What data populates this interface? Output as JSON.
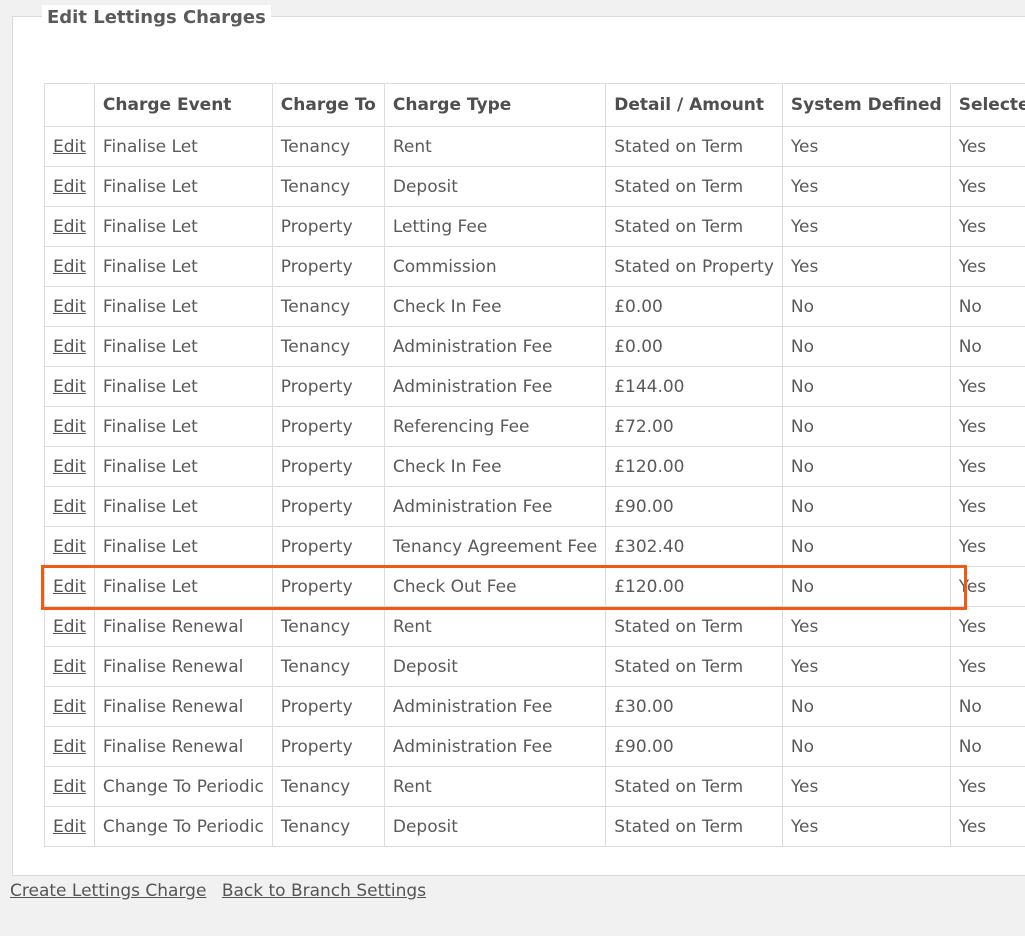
{
  "panel": {
    "title": "Edit Lettings Charges"
  },
  "table": {
    "headers": [
      "",
      "Charge Event",
      "Charge To",
      "Charge Type",
      "Detail / Amount",
      "System Defined",
      "Selected"
    ],
    "rows": [
      {
        "edit": "Edit",
        "event": "Finalise Let",
        "to": "Tenancy",
        "type": "Rent",
        "detail": "Stated on Term",
        "system": "Yes",
        "selected": "Yes"
      },
      {
        "edit": "Edit",
        "event": "Finalise Let",
        "to": "Tenancy",
        "type": "Deposit",
        "detail": "Stated on Term",
        "system": "Yes",
        "selected": "Yes"
      },
      {
        "edit": "Edit",
        "event": "Finalise Let",
        "to": "Property",
        "type": "Letting Fee",
        "detail": "Stated on Term",
        "system": "Yes",
        "selected": "Yes"
      },
      {
        "edit": "Edit",
        "event": "Finalise Let",
        "to": "Property",
        "type": "Commission",
        "detail": "Stated on Property",
        "system": "Yes",
        "selected": "Yes"
      },
      {
        "edit": "Edit",
        "event": "Finalise Let",
        "to": "Tenancy",
        "type": "Check In Fee",
        "detail": "£0.00",
        "system": "No",
        "selected": "No"
      },
      {
        "edit": "Edit",
        "event": "Finalise Let",
        "to": "Tenancy",
        "type": "Administration Fee",
        "detail": "£0.00",
        "system": "No",
        "selected": "No"
      },
      {
        "edit": "Edit",
        "event": "Finalise Let",
        "to": "Property",
        "type": "Administration Fee",
        "detail": "£144.00",
        "system": "No",
        "selected": "Yes"
      },
      {
        "edit": "Edit",
        "event": "Finalise Let",
        "to": "Property",
        "type": "Referencing Fee",
        "detail": "£72.00",
        "system": "No",
        "selected": "Yes"
      },
      {
        "edit": "Edit",
        "event": "Finalise Let",
        "to": "Property",
        "type": "Check In Fee",
        "detail": "£120.00",
        "system": "No",
        "selected": "Yes"
      },
      {
        "edit": "Edit",
        "event": "Finalise Let",
        "to": "Property",
        "type": "Administration Fee",
        "detail": "£90.00",
        "system": "No",
        "selected": "Yes"
      },
      {
        "edit": "Edit",
        "event": "Finalise Let",
        "to": "Property",
        "type": "Tenancy Agreement Fee",
        "detail": "£302.40",
        "system": "No",
        "selected": "Yes"
      },
      {
        "edit": "Edit",
        "event": "Finalise Let",
        "to": "Property",
        "type": "Check Out Fee",
        "detail": "£120.00",
        "system": "No",
        "selected": "Yes"
      },
      {
        "edit": "Edit",
        "event": "Finalise Renewal",
        "to": "Tenancy",
        "type": "Rent",
        "detail": "Stated on Term",
        "system": "Yes",
        "selected": "Yes"
      },
      {
        "edit": "Edit",
        "event": "Finalise Renewal",
        "to": "Tenancy",
        "type": "Deposit",
        "detail": "Stated on Term",
        "system": "Yes",
        "selected": "Yes"
      },
      {
        "edit": "Edit",
        "event": "Finalise Renewal",
        "to": "Property",
        "type": "Administration Fee",
        "detail": "£30.00",
        "system": "No",
        "selected": "No"
      },
      {
        "edit": "Edit",
        "event": "Finalise Renewal",
        "to": "Property",
        "type": "Administration Fee",
        "detail": "£90.00",
        "system": "No",
        "selected": "No"
      },
      {
        "edit": "Edit",
        "event": "Change To Periodic",
        "to": "Tenancy",
        "type": "Rent",
        "detail": "Stated on Term",
        "system": "Yes",
        "selected": "Yes"
      },
      {
        "edit": "Edit",
        "event": "Change To Periodic",
        "to": "Tenancy",
        "type": "Deposit",
        "detail": "Stated on Term",
        "system": "Yes",
        "selected": "Yes"
      }
    ]
  },
  "highlight": {
    "color": "#f05a14"
  },
  "footer": {
    "create_label": "Create Lettings Charge",
    "back_label": "Back to Branch Settings"
  }
}
